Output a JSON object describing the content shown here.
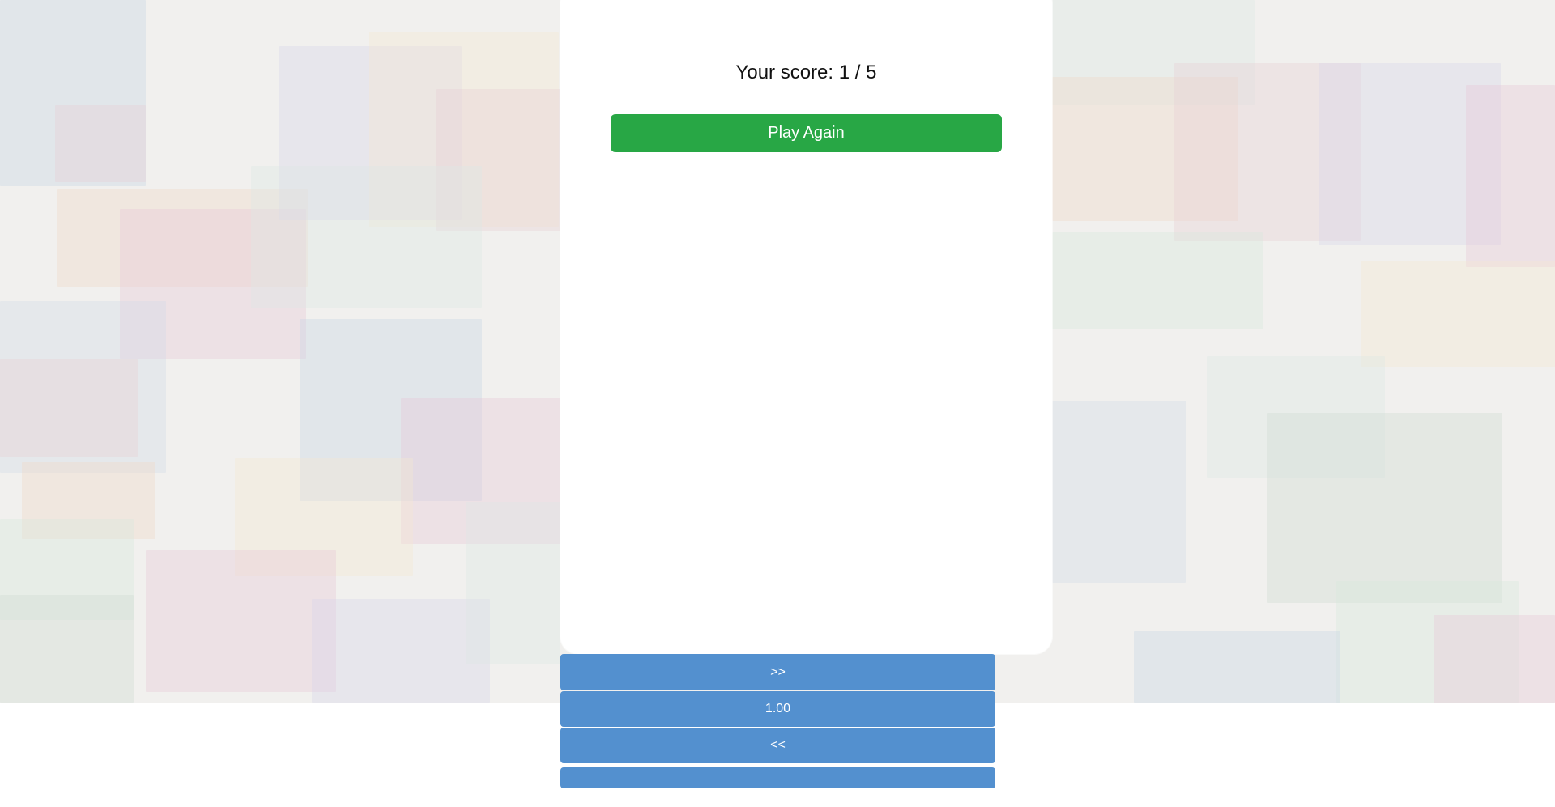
{
  "background": {
    "tile_colors": [
      "#c8d6e6",
      "#e7c8d8",
      "#d7d4ea",
      "#dce8e4",
      "#f0d8c8",
      "#e8d0d4",
      "#d8e7dc",
      "#d3dbe8",
      "#f5e7d3",
      "#cfd9d3"
    ]
  },
  "result": {
    "score_text": "Your score: 1 / 5",
    "play_again_label": "Play Again"
  },
  "controls": {
    "next_label": ">>",
    "speed_value": "1.00",
    "previous_label": "<<",
    "extra_label": ""
  },
  "colors": {
    "primary_button": "#28a745",
    "control_button": "#5390cf"
  }
}
